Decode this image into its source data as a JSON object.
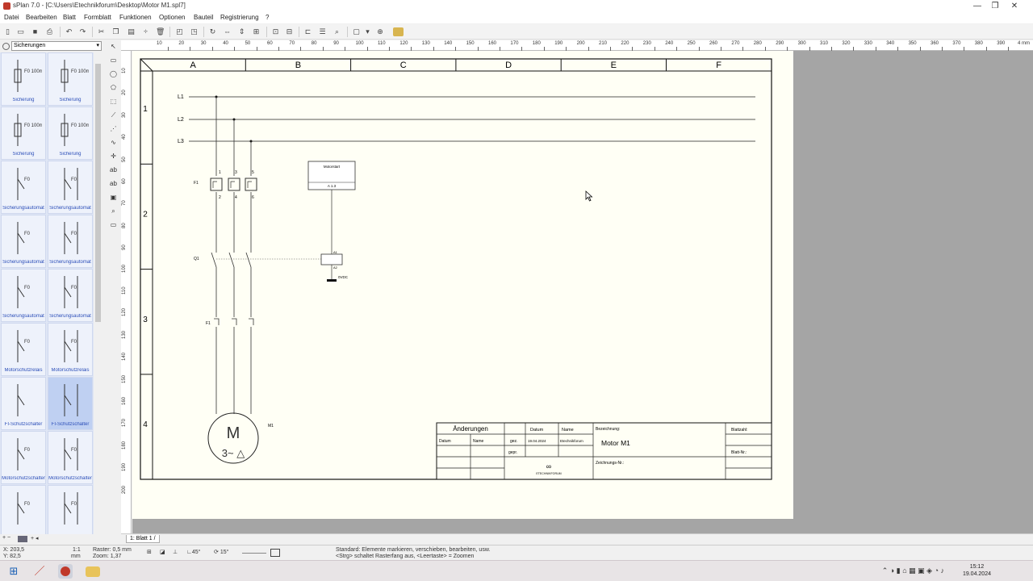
{
  "window": {
    "title": "sPlan 7.0 - [C:\\Users\\Etechnikforum\\Desktop\\Motor M1.spl7]",
    "min": "—",
    "max": "❐",
    "close": "✕"
  },
  "menu": [
    "Datei",
    "Bearbeiten",
    "Blatt",
    "Formblatt",
    "Funktionen",
    "Optionen",
    "Bauteil",
    "Registrierung",
    "?"
  ],
  "library": {
    "selected_group": "Sicherungen",
    "items": [
      {
        "label": "Sicherung",
        "sym": "F0 100mA"
      },
      {
        "label": "Sicherung",
        "sym": "F0 100mA"
      },
      {
        "label": "Sicherung",
        "sym": "F0 100mA"
      },
      {
        "label": "Sicherung",
        "sym": "F0 100mA"
      },
      {
        "label": "Sicherungsautomat",
        "sym": "F0"
      },
      {
        "label": "Sicherungsautomat",
        "sym": "F0"
      },
      {
        "label": "Sicherungsautomat",
        "sym": "F0"
      },
      {
        "label": "Sicherungsautomat",
        "sym": "F0"
      },
      {
        "label": "Sicherungsautomat",
        "sym": "F0"
      },
      {
        "label": "Sicherungsautomat",
        "sym": "F0"
      },
      {
        "label": "Motorschutzrelais",
        "sym": "F0"
      },
      {
        "label": "Motorschutzrelais",
        "sym": "F0"
      },
      {
        "label": "FI-Schutzschalter",
        "sym": ""
      },
      {
        "label": "FI-Schutzschalter",
        "sym": ""
      },
      {
        "label": "Motorschutzschalter",
        "sym": "F0"
      },
      {
        "label": "Motorschutzschalter",
        "sym": "F0"
      },
      {
        "label": "",
        "sym": "F0"
      },
      {
        "label": "",
        "sym": "F0"
      }
    ]
  },
  "ruler": {
    "unit": "4 mm",
    "h_ticks": [
      "10",
      "20",
      "30",
      "40",
      "50",
      "60",
      "70",
      "80",
      "90",
      "100",
      "110",
      "120",
      "130",
      "140",
      "150",
      "160",
      "170",
      "180",
      "190",
      "200",
      "210",
      "220",
      "230",
      "240",
      "250",
      "260",
      "270",
      "280",
      "290",
      "300",
      "310",
      "320",
      "330",
      "340",
      "350",
      "360",
      "370",
      "380",
      "390"
    ],
    "v_ticks": [
      "10",
      "20",
      "30",
      "40",
      "50",
      "60",
      "70",
      "80",
      "90",
      "100",
      "110",
      "120",
      "130",
      "140",
      "150",
      "160",
      "170",
      "180",
      "190",
      "200"
    ]
  },
  "sheet": {
    "columns": [
      "A",
      "B",
      "C",
      "D",
      "E",
      "F"
    ],
    "rows": [
      "1",
      "2",
      "3",
      "4"
    ],
    "phases": [
      "L1",
      "L2",
      "L3"
    ],
    "fuse_label": "F1",
    "contactor_label": "Q1",
    "overload_label": "F1",
    "motor_label": "M1",
    "motor_M": "M",
    "motor_type": "3~ △",
    "coil_pins": [
      "A1",
      "A2"
    ],
    "coil_voltage": "0VDC",
    "terminal_numbers_top": [
      "1",
      "3",
      "5"
    ],
    "terminal_numbers_bottom": [
      "2",
      "4",
      "6"
    ],
    "ref_box_top": "Motorstart",
    "ref_box_bottom": "A 1.3"
  },
  "titleblock": {
    "aenderungen": "Änderungen",
    "datum_h": "Datum",
    "name_h": "Name",
    "datum2": "Datum",
    "name2": "Name",
    "gez": "gez.",
    "gepr": "gepr.",
    "gez_datum": "19.04.2024",
    "gez_name": "Etechnikforum",
    "bezeichnung_label": "Bezeichnung:",
    "bezeichnung": "Motor M1",
    "blattzahl": "Blattzahl:",
    "blattnr": "Blatt-Nr.:",
    "zeichnungsnr": "Zeichnungs-Nr.:",
    "logo_text": "ETECHNIKFORUM"
  },
  "tabs": {
    "sheet_tab": "1: Blatt 1 /"
  },
  "status": {
    "coords": [
      "X: 203,5",
      "Y: 82,5"
    ],
    "scale": [
      "1:1",
      "mm"
    ],
    "grid": "Raster: 0,5 mm",
    "zoom": "Zoom: 1,37",
    "angle1": "45°",
    "angle2": "15°",
    "hint1": "Standard: Elemente markieren, verschieben, bearbeiten, usw.",
    "hint2": "<Strg> schaltet Rasterfang aus, <Leertaste> = Zoomen"
  },
  "taskbar": {
    "time": "15:12",
    "date": "19.04.2024"
  }
}
